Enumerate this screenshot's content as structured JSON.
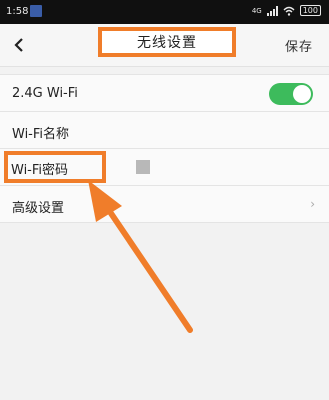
{
  "status_bar": {
    "time": "1:58",
    "signal_label": "4G",
    "battery": "100"
  },
  "header": {
    "title": "无线设置",
    "save_label": "保存"
  },
  "settings": {
    "band_label": "2.4G Wi-Fi",
    "band_enabled": true,
    "name_label": "Wi-Fi名称",
    "password_label": "Wi-Fi密码",
    "advanced_label": "高级设置"
  },
  "icons": {
    "back": "chevron-left-icon",
    "wifi": "wifi-icon",
    "chevron": "chevron-right-icon",
    "notification": "notification-icon"
  },
  "colors": {
    "highlight": "#f07d2a",
    "toggle_on": "#3dbb5c"
  }
}
